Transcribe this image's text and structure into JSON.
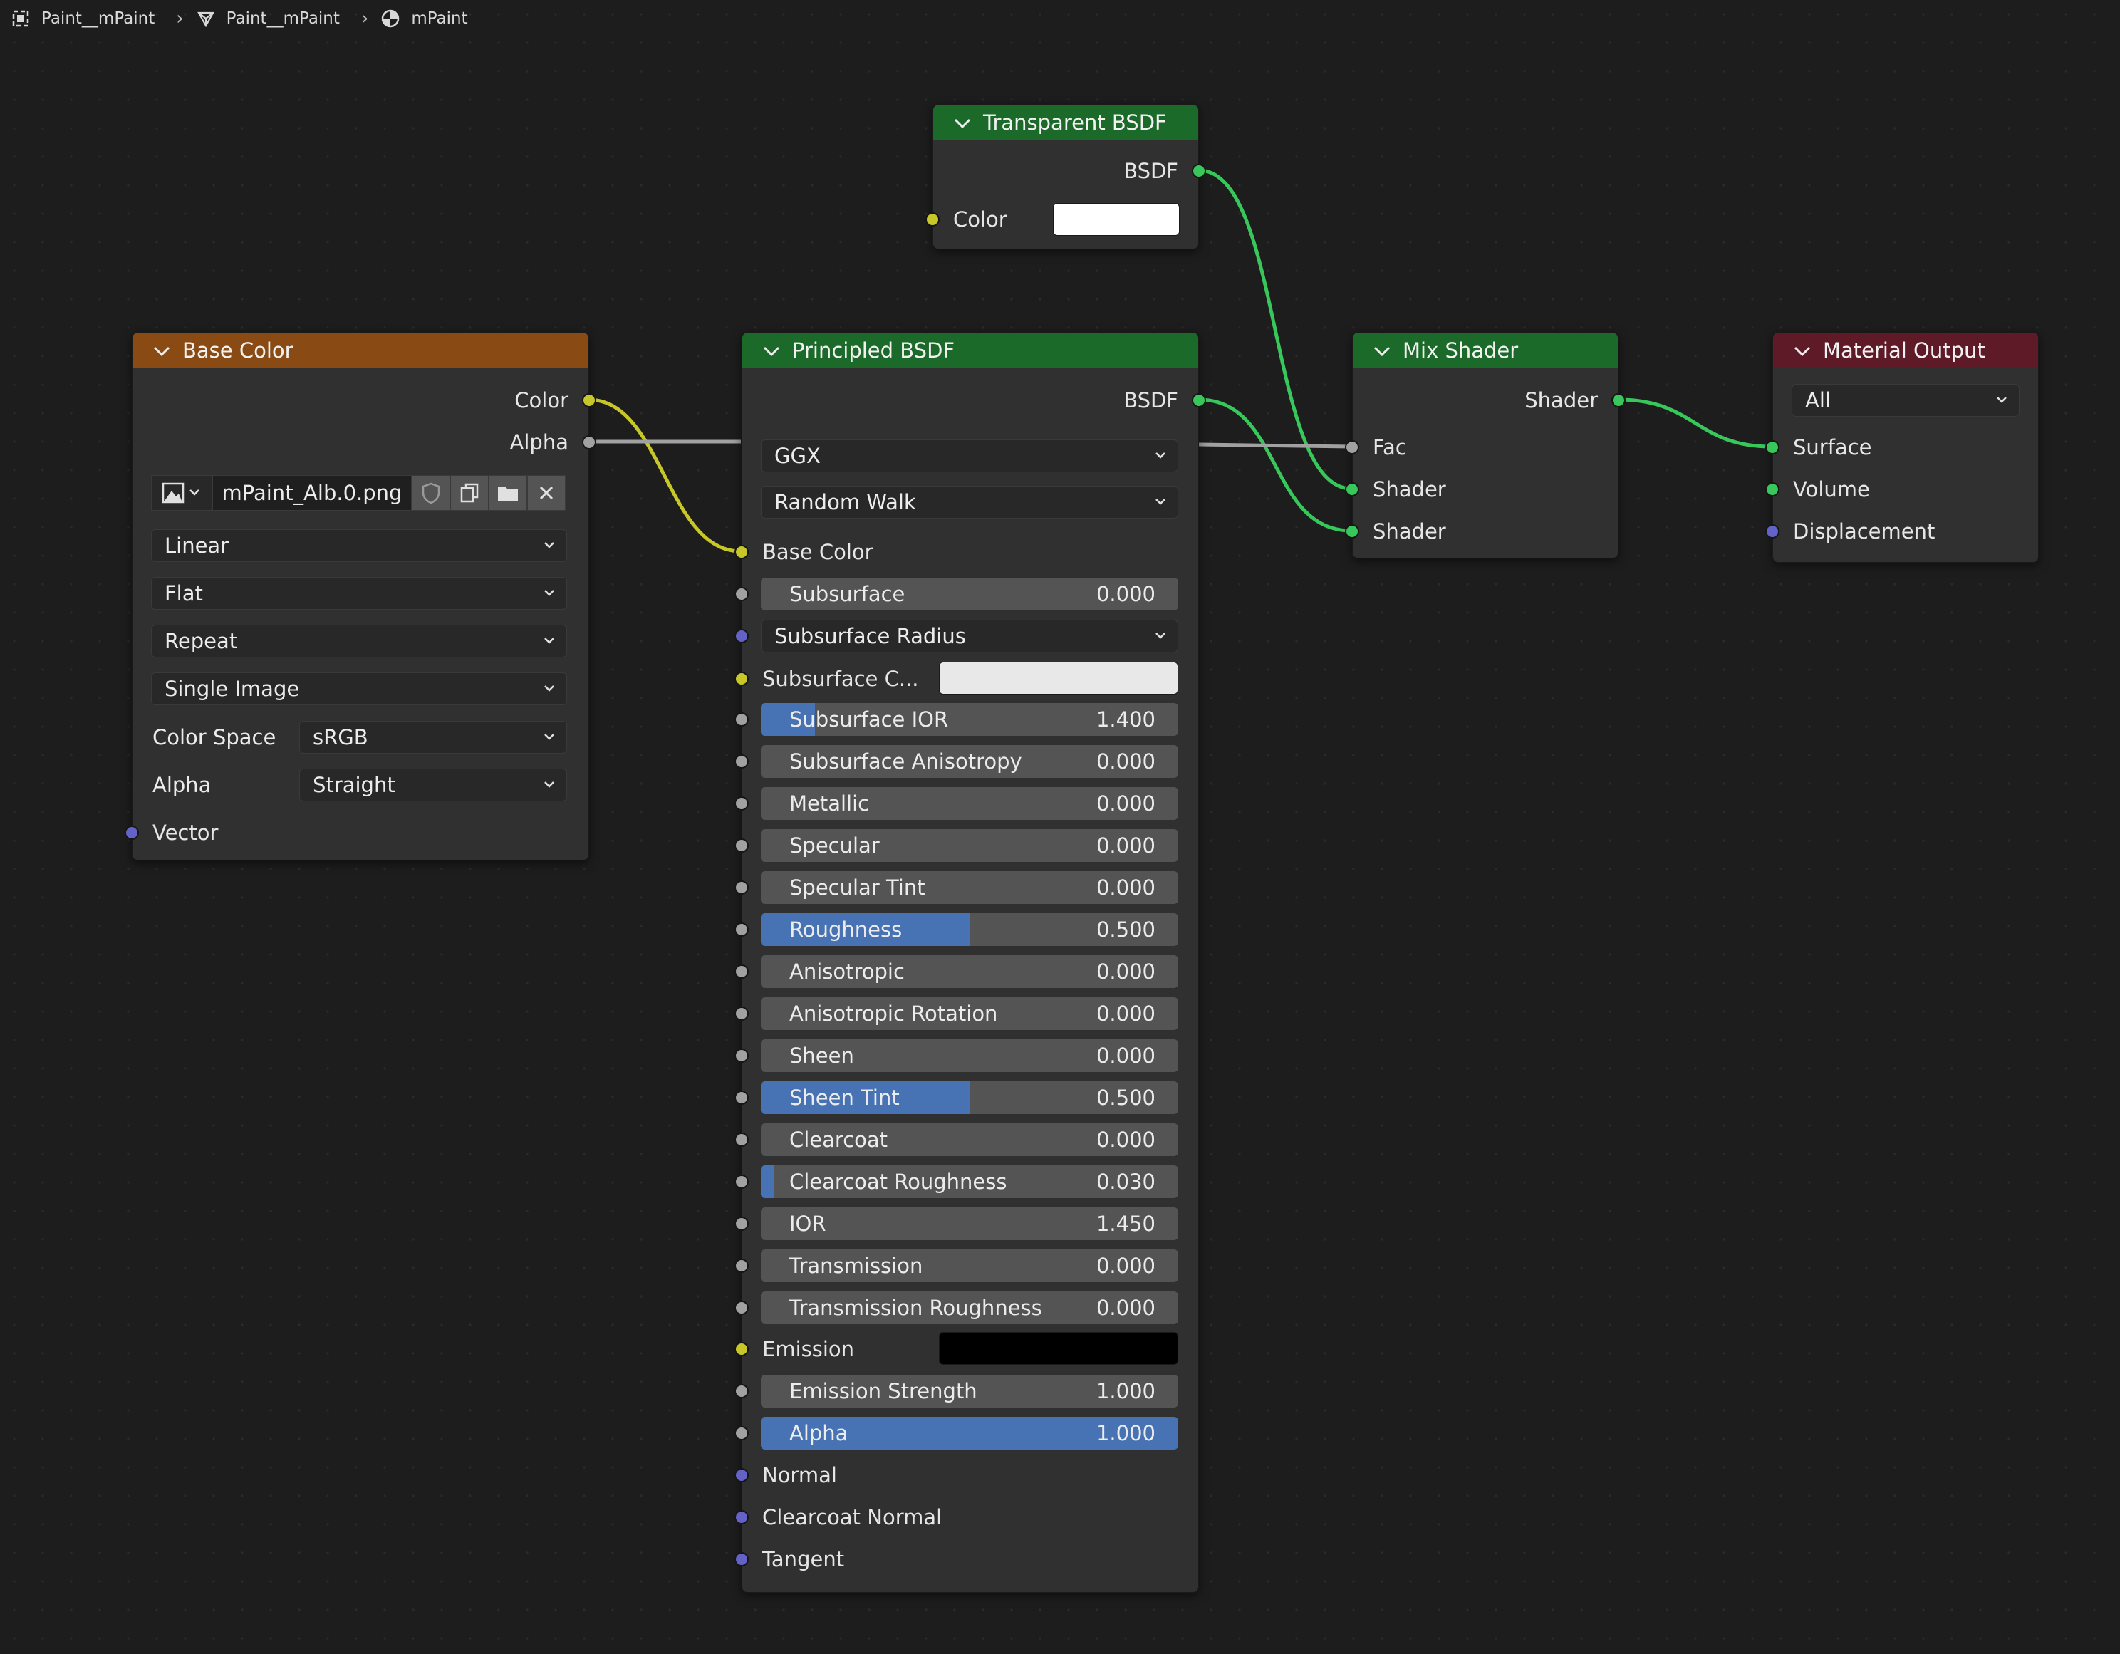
{
  "breadcrumb": {
    "items": [
      {
        "label": "Paint__mPaint",
        "icon": "object-icon"
      },
      {
        "label": "Paint__mPaint",
        "icon": "mesh-icon"
      },
      {
        "label": "mPaint",
        "icon": "material-icon"
      }
    ]
  },
  "colors": {
    "socket_color": "#c7c729",
    "socket_float": "#a1a1a1",
    "socket_shader": "#38c75a",
    "socket_vector": "#6363c7",
    "link_shader": "#38c75a",
    "link_color": "#c7c729",
    "link_float": "#a1a1a1",
    "slider_fill": "#4772b3"
  },
  "nodes": {
    "transparent": {
      "title": "Transparent BSDF",
      "output": "BSDF",
      "input_color_label": "Color",
      "color_value": "#ffffff"
    },
    "base_color": {
      "title": "Base Color",
      "outputs": {
        "color": "Color",
        "alpha": "Alpha"
      },
      "image_name": "mPaint_Alb.0.png",
      "interpolation": "Linear",
      "projection": "Flat",
      "extension": "Repeat",
      "source": "Single Image",
      "color_space_label": "Color Space",
      "color_space": "sRGB",
      "alpha_label": "Alpha",
      "alpha_mode": "Straight",
      "vector_label": "Vector"
    },
    "principled": {
      "title": "Principled BSDF",
      "output": "BSDF",
      "distribution": "GGX",
      "subsurface_method": "Random Walk",
      "base_color_label": "Base Color",
      "subsurface": {
        "label": "Subsurface",
        "value": "0.000",
        "fill": 0
      },
      "subsurface_radius": "Subsurface Radius",
      "subsurface_color": {
        "label": "Subsurface C...",
        "color": "#e8e8e8"
      },
      "sliders": [
        {
          "label": "Subsurface IOR",
          "value": "1.400",
          "fill": 0.13
        },
        {
          "label": "Subsurface Anisotropy",
          "value": "0.000",
          "fill": 0
        },
        {
          "label": "Metallic",
          "value": "0.000",
          "fill": 0
        },
        {
          "label": "Specular",
          "value": "0.000",
          "fill": 0
        },
        {
          "label": "Specular Tint",
          "value": "0.000",
          "fill": 0
        },
        {
          "label": "Roughness",
          "value": "0.500",
          "fill": 0.5
        },
        {
          "label": "Anisotropic",
          "value": "0.000",
          "fill": 0
        },
        {
          "label": "Anisotropic Rotation",
          "value": "0.000",
          "fill": 0
        },
        {
          "label": "Sheen",
          "value": "0.000",
          "fill": 0
        },
        {
          "label": "Sheen Tint",
          "value": "0.500",
          "fill": 0.5
        },
        {
          "label": "Clearcoat",
          "value": "0.000",
          "fill": 0
        },
        {
          "label": "Clearcoat Roughness",
          "value": "0.030",
          "fill": 0.03
        },
        {
          "label": "IOR",
          "value": "1.450",
          "fill": 0
        },
        {
          "label": "Transmission",
          "value": "0.000",
          "fill": 0
        },
        {
          "label": "Transmission Roughness",
          "value": "0.000",
          "fill": 0
        }
      ],
      "emission": {
        "label": "Emission",
        "color": "#000000"
      },
      "emission_strength": {
        "label": "Emission Strength",
        "value": "1.000",
        "fill": 0
      },
      "alpha": {
        "label": "Alpha",
        "value": "1.000",
        "fill": 1
      },
      "normal": "Normal",
      "clearcoat_normal": "Clearcoat Normal",
      "tangent": "Tangent"
    },
    "mix": {
      "title": "Mix Shader",
      "output": "Shader",
      "fac": "Fac",
      "shader1": "Shader",
      "shader2": "Shader"
    },
    "output": {
      "title": "Material Output",
      "target": "All",
      "surface": "Surface",
      "volume": "Volume",
      "displacement": "Displacement"
    }
  }
}
